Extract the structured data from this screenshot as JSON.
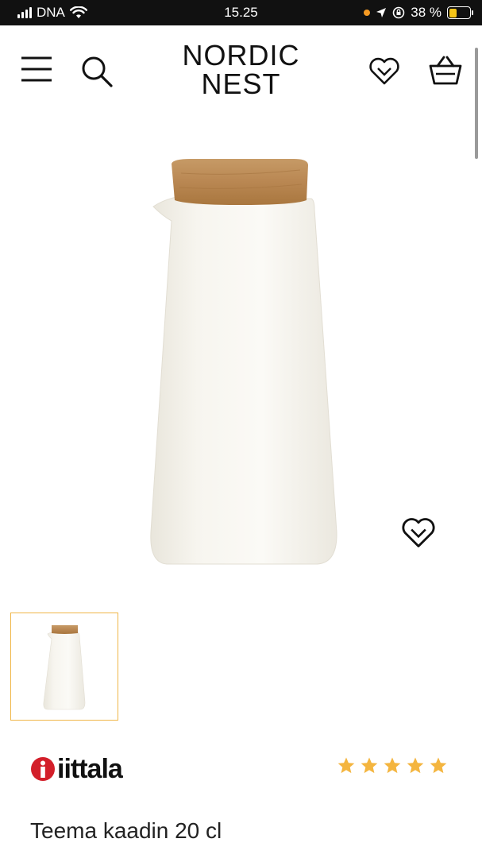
{
  "status_bar": {
    "carrier": "DNA",
    "time": "15.25",
    "battery_percent": "38 %",
    "battery_level": 0.38
  },
  "header": {
    "logo_line1": "NORDIC",
    "logo_line2": "NEST",
    "icons": [
      "menu-icon",
      "search-icon",
      "wishlist-heart-icon",
      "shopping-basket-icon"
    ]
  },
  "product": {
    "brand": "iittala",
    "name": "Teema kaadin 20 cl",
    "rating": 5,
    "rating_max": 5
  },
  "colors": {
    "accent": "#f0b648",
    "star": "#f4b53f",
    "brand_red": "#d31f2a",
    "status_bar": "#111111"
  }
}
